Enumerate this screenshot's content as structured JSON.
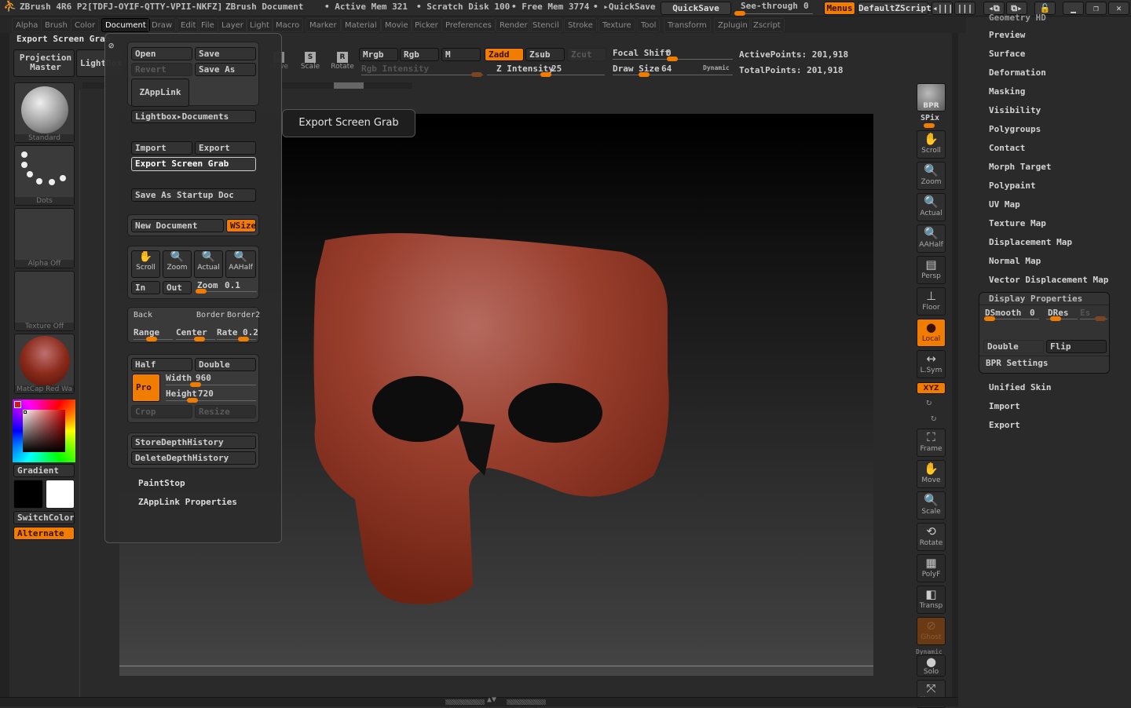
{
  "titlebar": {
    "app_title": "ZBrush 4R6 P2[TDFJ-OYIF-QTTY-VPII-NKFZ]",
    "doc_title": "ZBrush Document",
    "active_mem": "• Active Mem 321",
    "scratch_disk": "• Scratch Disk 100",
    "free_mem": "• Free Mem 3774",
    "quicksave_status": "• ▸QuickSave",
    "quicksave_button": "QuickSave",
    "see_through_label": "See-through",
    "see_through_value": "0",
    "menus_button": "Menus",
    "default_zscript": "DefaultZScript",
    "icons": [
      "prev-layout-icon",
      "next-layout-icon",
      "prev-color-icon",
      "next-color-icon",
      "lock-icon",
      "minimize-icon",
      "restore-icon",
      "close-icon"
    ]
  },
  "menubar": {
    "items": [
      "Alpha",
      "Brush",
      "Color",
      "Document",
      "Draw",
      "Edit",
      "File",
      "Layer",
      "Light",
      "Macro",
      "Marker",
      "Material",
      "Movie",
      "Picker",
      "Preferences",
      "Render",
      "Stencil",
      "Stroke",
      "Texture",
      "Tool",
      "Transform",
      "Zplugin",
      "Zscript"
    ],
    "active": "Document"
  },
  "status_label": "Export Screen Grab",
  "leftpanel": {
    "projection_master": "Projection Master",
    "lightbox": "LightBox",
    "brush_caption": "Standard",
    "stroke_caption": "Dots",
    "alpha_caption": "Alpha  Off",
    "texture_caption": "Texture  Off",
    "material_caption": "MatCap  Red  Wa",
    "gradient_label": "Gradient",
    "switchcolor_label": "SwitchColor",
    "alternate_label": "Alternate",
    "main_color": "#cc1a1a",
    "secondary_color": "#ffffff"
  },
  "toolbar": {
    "move_label": "Move",
    "scale_label": "Scale",
    "rotate_label": "Rotate",
    "mrgb": "Mrgb",
    "rgb": "Rgb",
    "m": "M",
    "zadd": "Zadd",
    "zsub": "Zsub",
    "zcut": "Zcut",
    "rgb_intensity": "Rgb  Intensity",
    "z_intensity_label": "Z  Intensity",
    "z_intensity_value": "25",
    "focal_shift_label": "Focal  Shift",
    "focal_shift_value": "0",
    "draw_size_label": "Draw  Size",
    "draw_size_value": "64",
    "dynamic_label": "Dynamic",
    "active_points": "ActivePoints: 201,918",
    "total_points": "TotalPoints: 201,918"
  },
  "document_menu": {
    "open": "Open",
    "save": "Save",
    "revert": "Revert",
    "save_as": "Save As",
    "zapplink": "ZAppLink",
    "lightbox_documents": "Lightbox▸Documents",
    "import": "Import",
    "export": "Export",
    "export_screen_grab": "Export Screen Grab",
    "save_as_startup_doc": "Save As Startup Doc",
    "new_document": "New Document",
    "wsize": "WSize",
    "scroll": "Scroll",
    "zoom": "Zoom",
    "actual": "Actual",
    "aahalf": "AAHalf",
    "in": "In",
    "out": "Out",
    "zoom_slider_label": "Zoom",
    "zoom_slider_value": "0.1",
    "back": "Back",
    "border": "Border",
    "border2": "Border2",
    "range": "Range",
    "center": "Center",
    "rate_label": "Rate",
    "rate_value": "0.2",
    "half": "Half",
    "double": "Double",
    "pro": "Pro",
    "width_label": "Width",
    "width_value": "960",
    "height_label": "Height",
    "height_value": "720",
    "crop": "Crop",
    "resize": "Resize",
    "store_depth_history": "StoreDepthHistory",
    "delete_depth_history": "DeleteDepthHistory",
    "paintstop": "PaintStop",
    "zapplink_properties": "ZAppLink Properties"
  },
  "tooltip": "Export Screen Grab",
  "rightshelf": {
    "bpr": "BPR",
    "spix": "SPix",
    "scroll": "Scroll",
    "zoom": "Zoom",
    "actual": "Actual",
    "aahalf": "AAHalf",
    "persp": "Persp",
    "floor": "Floor",
    "local": "Local",
    "lsym": "L.Sym",
    "xyz": "XYZ",
    "frame": "Frame",
    "move": "Move",
    "scale": "Scale",
    "rotate": "Rotate",
    "polyf": "PolyF",
    "transp": "Transp",
    "ghost": "Ghost",
    "dynamic": "Dynamic",
    "solo": "Solo",
    "xpose": "Xpose"
  },
  "rightpanel": {
    "cut_item": "Geometry HD",
    "items": [
      "Preview",
      "Surface",
      "Deformation",
      "Masking",
      "Visibility",
      "Polygroups",
      "Contact",
      "Morph Target",
      "Polypaint",
      "UV Map",
      "Texture Map",
      "Displacement Map",
      "Normal Map",
      "Vector Displacement Map"
    ],
    "display_properties": {
      "title": "Display Properties",
      "dsmooth_label": "DSmooth",
      "dsmooth_value": "0",
      "dres": "DRes",
      "es": "Es",
      "double": "Double",
      "flip": "Flip",
      "bpr_settings": "BPR Settings"
    },
    "items_after": [
      "Unified Skin",
      "Import",
      "Export"
    ]
  }
}
